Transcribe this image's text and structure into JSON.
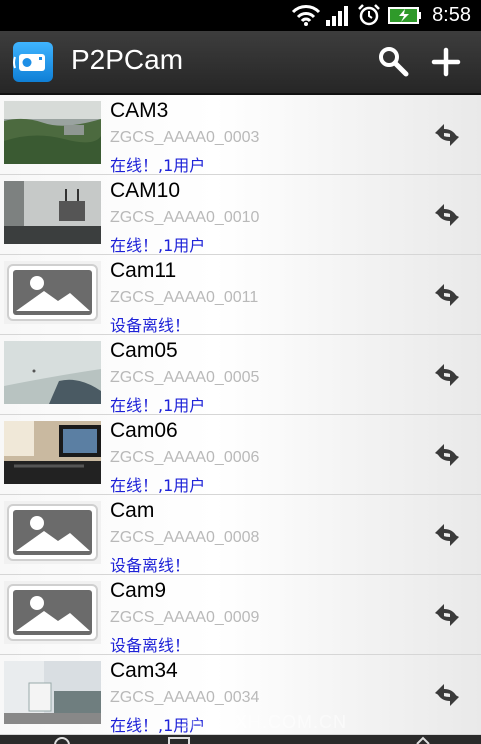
{
  "status_bar": {
    "time": "8:58",
    "icons": [
      "wifi-icon",
      "signal-icon",
      "alarm-icon",
      "battery-charging-icon"
    ]
  },
  "app_bar": {
    "title": "P2PCam",
    "icons": [
      "app-logo-icon",
      "search-icon",
      "add-icon"
    ],
    "accent": "#1e8fe6"
  },
  "cameras": [
    {
      "name": "CAM3",
      "uid": "ZGCS_AAAA0_0003",
      "status": "在线！,1用户",
      "thumb": "snapshot"
    },
    {
      "name": "CAM10",
      "uid": "ZGCS_AAAA0_0010",
      "status": "在线！,1用户",
      "thumb": "snapshot"
    },
    {
      "name": "Cam11",
      "uid": "ZGCS_AAAA0_0011",
      "status": "设备离线！",
      "thumb": "placeholder"
    },
    {
      "name": "Cam05",
      "uid": "ZGCS_AAAA0_0005",
      "status": "在线！,1用户",
      "thumb": "snapshot"
    },
    {
      "name": "Cam06",
      "uid": "ZGCS_AAAA0_0006",
      "status": "在线！,1用户",
      "thumb": "snapshot"
    },
    {
      "name": "Cam",
      "uid": "ZGCS_AAAA0_0008",
      "status": "设备离线！",
      "thumb": "placeholder"
    },
    {
      "name": "Cam9",
      "uid": "ZGCS_AAAA0_0009",
      "status": "设备离线！",
      "thumb": "placeholder"
    },
    {
      "name": "Cam34",
      "uid": "ZGCS_AAAA0_0034",
      "status": "在线！,1用户",
      "thumb": "snapshot"
    }
  ],
  "row_action_icon": "reconnect-icon",
  "status_color": "#1e22d8",
  "watermark": "3BWYXH.COM.CN",
  "bottom_bar": {
    "icons": [
      "info-icon",
      "list-icon",
      "up-icon"
    ]
  }
}
